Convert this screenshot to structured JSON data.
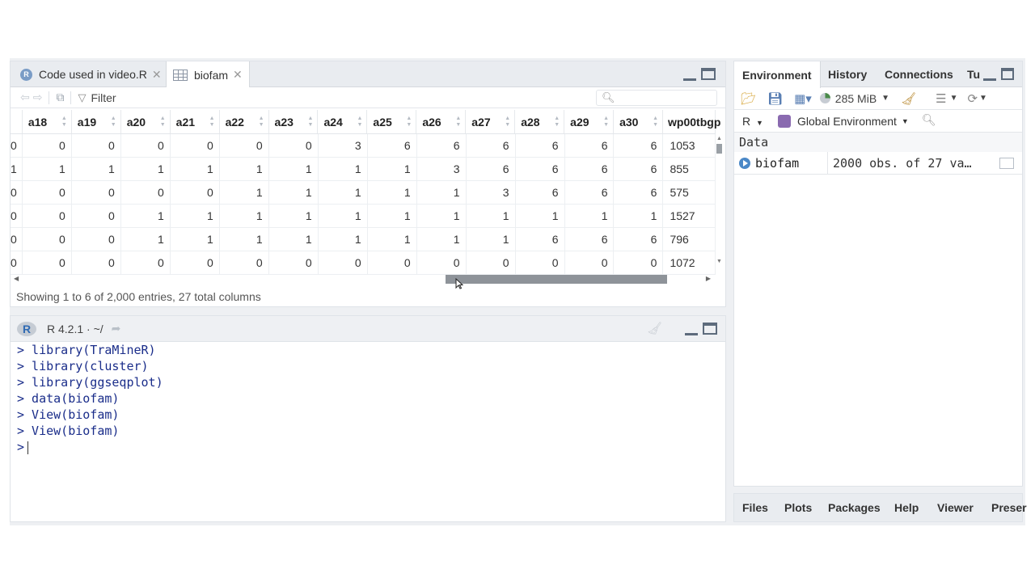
{
  "source_tabs": {
    "tab1_label": "Code used in video.R",
    "tab2_label": "biofam"
  },
  "viewer": {
    "filter_label": "Filter",
    "columns": [
      "a18",
      "a19",
      "a20",
      "a21",
      "a22",
      "a23",
      "a24",
      "a25",
      "a26",
      "a27",
      "a28",
      "a29",
      "a30",
      "wp00tbgp"
    ],
    "rows": [
      {
        "first": "0",
        "cells": [
          "0",
          "0",
          "0",
          "0",
          "0",
          "0",
          "3",
          "6",
          "6",
          "6",
          "6",
          "6",
          "6",
          "1053"
        ]
      },
      {
        "first": "1",
        "cells": [
          "1",
          "1",
          "1",
          "1",
          "1",
          "1",
          "1",
          "1",
          "3",
          "6",
          "6",
          "6",
          "6",
          "855"
        ]
      },
      {
        "first": "0",
        "cells": [
          "0",
          "0",
          "0",
          "0",
          "1",
          "1",
          "1",
          "1",
          "1",
          "3",
          "6",
          "6",
          "6",
          "575"
        ]
      },
      {
        "first": "0",
        "cells": [
          "0",
          "0",
          "1",
          "1",
          "1",
          "1",
          "1",
          "1",
          "1",
          "1",
          "1",
          "1",
          "1",
          "1527"
        ]
      },
      {
        "first": "0",
        "cells": [
          "0",
          "0",
          "1",
          "1",
          "1",
          "1",
          "1",
          "1",
          "1",
          "1",
          "6",
          "6",
          "6",
          "796"
        ]
      },
      {
        "first": "0",
        "cells": [
          "0",
          "0",
          "0",
          "0",
          "0",
          "0",
          "0",
          "0",
          "0",
          "0",
          "0",
          "0",
          "0",
          "1072"
        ]
      }
    ],
    "status": "Showing 1 to 6 of 2,000 entries, 27 total columns"
  },
  "console": {
    "version": "R 4.2.1 · ~/",
    "lines": [
      "> library(TraMineR)",
      "> library(cluster)",
      "> library(ggseqplot)",
      "> data(biofam)",
      "> View(biofam)",
      "> View(biofam)"
    ],
    "prompt": ">"
  },
  "environment": {
    "tabs": [
      "Environment",
      "History",
      "Connections",
      "Tu"
    ],
    "memory": "285 MiB",
    "language": "R",
    "scope": "Global Environment",
    "section": "Data",
    "objects": [
      {
        "name": "biofam",
        "value": "2000 obs. of 27 va…"
      }
    ]
  },
  "files_tabs": [
    "Files",
    "Plots",
    "Packages",
    "Help",
    "Viewer",
    "Preser"
  ],
  "colors": {
    "console_text": "#1a2d8a",
    "accent_blue": "#4a88c7"
  }
}
